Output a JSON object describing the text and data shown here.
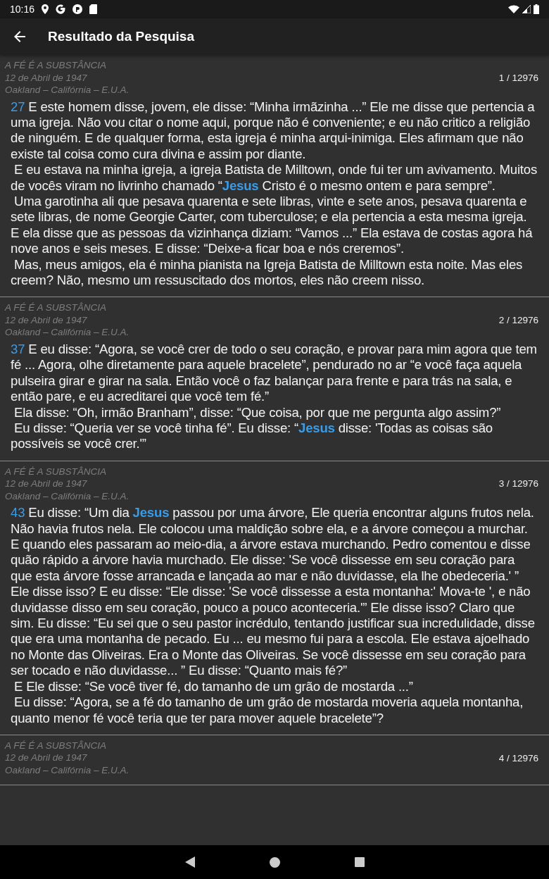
{
  "status_bar": {
    "time": "10:16"
  },
  "app_bar": {
    "title": "Resultado da Pesquisa"
  },
  "results": [
    {
      "sermon": "A FÉ É A SUBSTÂNCIA",
      "date": "12 de Abril de 1947",
      "place": "Oakland – Califórnia – E.U.A.",
      "counter": "1 / 12976",
      "number": "27",
      "paragraphs": [
        "E este homem disse, jovem, ele disse: “Minha irmãzinha ...” Ele me disse que pertencia a uma igreja. Não vou citar o nome aqui, porque não é conveniente; e eu não critico a religião de ninguém. E de qualquer forma, esta igreja é minha arqui-inimiga. Eles afirmam que não existe tal coisa como cura divina e assim por diante.",
        "E eu estava na minha igreja, a igreja Batista de Milltown, onde fui ter um avivamento. Muitos de vocês viram no livrinho chamado “**Jesus** Cristo é o mesmo ontem e para sempre”.",
        "Uma garotinha ali que pesava quarenta e sete libras, vinte e sete anos, pesava quarenta e sete libras, de nome Georgie Carter, com tuberculose; e ela pertencia a esta mesma igreja. E ela disse que as pessoas da vizinhança diziam: “Vamos ...” Ela estava de costas agora há nove anos e seis meses. E disse: “Deixe-a ficar boa e nós creremos”.",
        "Mas, meus amigos, ela é minha pianista na Igreja Batista de Milltown esta noite. Mas eles creem? Não, mesmo um ressuscitado dos mortos, eles não creem nisso."
      ]
    },
    {
      "sermon": "A FÉ É A SUBSTÂNCIA",
      "date": "12 de Abril de 1947",
      "place": "Oakland – Califórnia – E.U.A.",
      "counter": "2 / 12976",
      "number": "37",
      "paragraphs": [
        "E eu disse: “Agora, se você crer de todo o seu coração, e provar para mim agora que tem fé ... Agora, olhe diretamente para aquele bracelete”, pendurado no ar “e você faça aquela pulseira girar e girar na sala. Então você o faz balançar para frente e para trás na sala, e então pare, e eu acreditarei que você tem fé.”",
        "Ela disse: “Oh, irmão Branham”, disse: “Que coisa, por que me pergunta algo assim?”",
        "Eu disse: “Queria ver se você tinha fé”. Eu disse: “**Jesus** disse: 'Todas as coisas são possíveis se você crer.'”"
      ]
    },
    {
      "sermon": "A FÉ É A SUBSTÂNCIA",
      "date": "12 de Abril de 1947",
      "place": "Oakland – Califórnia – E.U.A.",
      "counter": "3 / 12976",
      "number": "43",
      "paragraphs": [
        "Eu disse: “Um dia **Jesus** passou por uma árvore, Ele queria encontrar alguns frutos nela. Não havia frutos nela. Ele colocou uma maldição sobre ela, e a árvore começou a murchar. E quando eles passaram ao meio-dia, a árvore estava murchando. Pedro comentou e disse quão rápido a árvore havia murchado. Ele disse: 'Se você dissesse em seu coração para que esta árvore fosse arrancada e lançada ao mar e não duvidasse, ela lhe obedeceria.' ” Ele disse isso? E eu disse: “Ele disse: 'Se você dissesse a esta montanha:' Mova-te ', e não duvidasse disso em seu coração, pouco a pouco aconteceria.'” Ele disse isso? Claro que sim. Eu disse: “Eu sei que o seu pastor incrédulo, tentando justificar sua incredulidade, disse que era uma montanha de pecado. Eu ... eu mesmo fui para a escola. Ele estava ajoelhado no Monte das Oliveiras. Era o Monte das Oliveiras. Se você dissesse em seu coração para ser tocado e não duvidasse... ” Eu disse: “Quanto mais fé?”",
        "E Ele disse: “Se você tiver fé, do tamanho de um grão de mostarda ...”",
        "Eu disse: “Agora, se a fé do tamanho de um grão de mostarda moveria aquela montanha, quanto menor fé você teria que ter para mover aquele bracelete”?"
      ]
    },
    {
      "sermon": "A FÉ É A SUBSTÂNCIA",
      "date": "12 de Abril de 1947",
      "place": "Oakland – Califórnia – E.U.A.",
      "counter": "4 / 12976"
    }
  ]
}
